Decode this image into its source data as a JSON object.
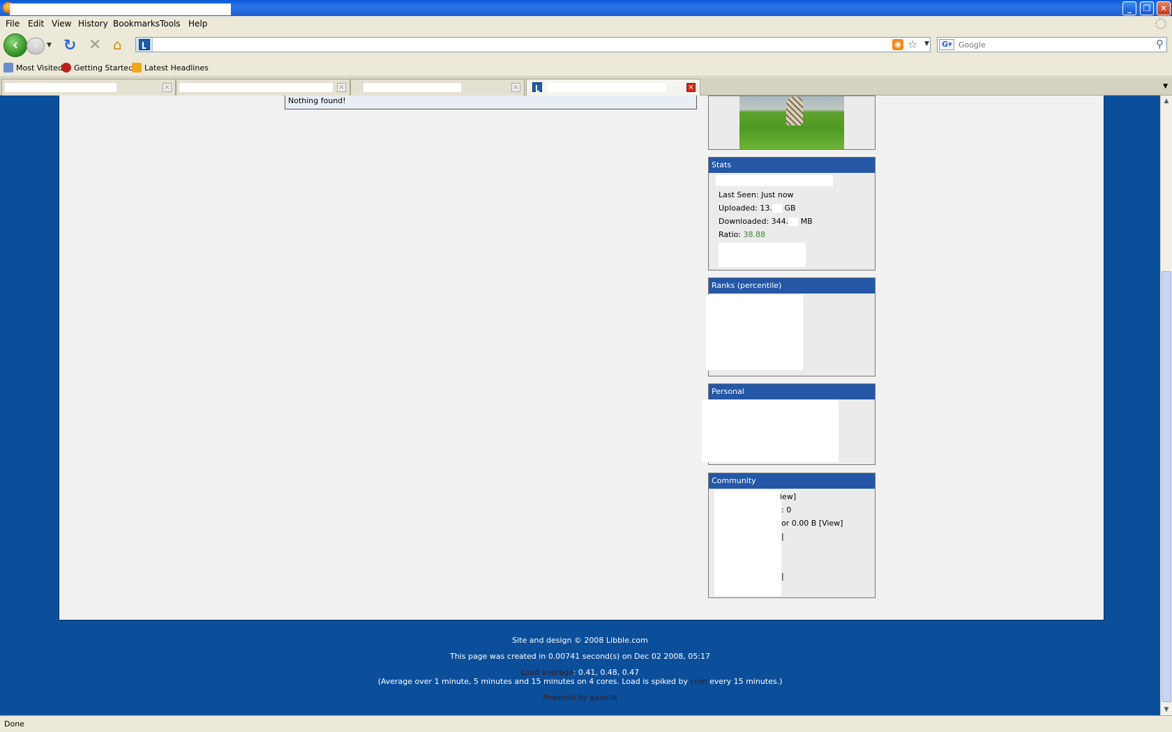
{
  "menu": {
    "file": "File",
    "edit": "Edit",
    "view": "View",
    "history": "History",
    "bookmarks": "Bookmarks",
    "tools": "Tools",
    "help": "Help"
  },
  "searchbar": {
    "placeholder": "Google"
  },
  "bookmarks_toolbar": {
    "most_visited": "Most Visited",
    "getting_started": "Getting Started",
    "latest_headlines": "Latest Headlines"
  },
  "content": {
    "search_result": "Nothing found!"
  },
  "stats_panel": {
    "header": "Stats",
    "last_seen": "Last Seen: Just now",
    "uploaded_prefix": "Uploaded: 13.",
    "uploaded_unit": "GB",
    "downloaded_prefix": "Downloaded: 344.",
    "downloaded_unit": "MB",
    "ratio_label": "Ratio:",
    "ratio_value": "38.88"
  },
  "ranks_panel": {
    "header": "Ranks (percentile)"
  },
  "personal_panel": {
    "header": "Personal"
  },
  "community_panel": {
    "header": "Community",
    "line1": "iew]",
    "line2": ": 0",
    "line3": "or 0.00 B [View]",
    "line4": "|",
    "line5": "|"
  },
  "footer": {
    "copyright": "Site and design © 2008 Libble.com",
    "created": "This page was created in 0.00741 second(s) on Dec 02 2008, 05:17",
    "load_label": "Load average",
    "load_values": ": 0.41, 0.48, 0.47",
    "load_note_prefix": "(Average over 1 minute, 5 minutes and 15 minutes on 4 cores. Load is spiked by",
    "load_note_link": "cron",
    "load_note_suffix": "every 15 minutes.)",
    "powered_by": "Powered by gazelle"
  },
  "status": {
    "text": "Done"
  }
}
